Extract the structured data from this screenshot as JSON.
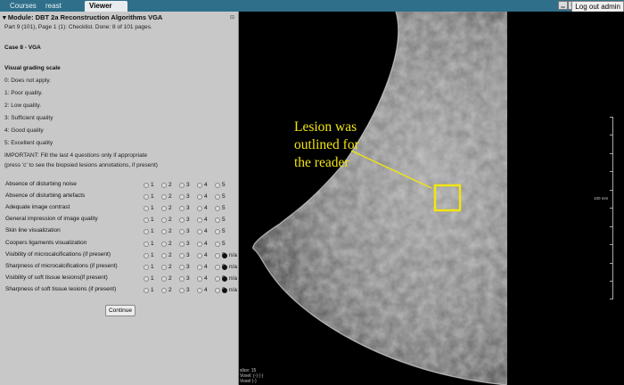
{
  "topbar": {
    "tabs": [
      {
        "label": "Courses"
      },
      {
        "label": "reast Tomce"
      },
      {
        "label": "Viewer"
      }
    ],
    "logout_label": "Log out admin"
  },
  "panel": {
    "module_title": "Module: DBT 2a Reconstruction Algorithms VGA",
    "progress": "Part 9 (101), Page 1 (1): Checklist. Done: 8 of 101 pages.",
    "case_title": "Case 8 - VGA",
    "scale_title": "Visual grading scale",
    "scale": [
      "0: Does not apply.",
      "1: Poor quality.",
      "2: Low quality.",
      "3: Sufficient quality",
      "4: Good quality",
      "5: Excellent quality"
    ],
    "important": "IMPORTANT: Fill the last 4 questions only if appropriate (press 'c' to see the biopsied lesions annotations, if present)",
    "option_labels": [
      "1",
      "2",
      "3",
      "4",
      "5"
    ],
    "na_label": "n/a",
    "questions": [
      {
        "label": "Absence of disturbing noise",
        "has_na": false
      },
      {
        "label": "Absence of disturbing artefacts",
        "has_na": false
      },
      {
        "label": "Adequate image contrast",
        "has_na": false
      },
      {
        "label": "General impression of image quality",
        "has_na": false
      },
      {
        "label": "Skin line visualization",
        "has_na": false
      },
      {
        "label": "Coopers ligaments visualization",
        "has_na": false
      },
      {
        "label": "Visibility of microcalcifications (if present)",
        "has_na": true
      },
      {
        "label": "Sharpness of microcalcifications (if present)",
        "has_na": true
      },
      {
        "label": "Visibility of soft tissue lesions(if present)",
        "has_na": true
      },
      {
        "label": "Sharpness of soft tissue lesions (if present)",
        "has_na": true
      }
    ],
    "continue_label": "Continue"
  },
  "viewer": {
    "annotation": [
      "Lesion was",
      "outlined for",
      "the reader"
    ],
    "ruler_label": "100 mm",
    "info": [
      "slice: 15",
      "Voxel: (-) (-)",
      "Voxel (-)"
    ],
    "colors": {
      "annotation": "#f3e50f",
      "topbar": "#2f6f8a",
      "panel": "#c8c8c8"
    }
  }
}
